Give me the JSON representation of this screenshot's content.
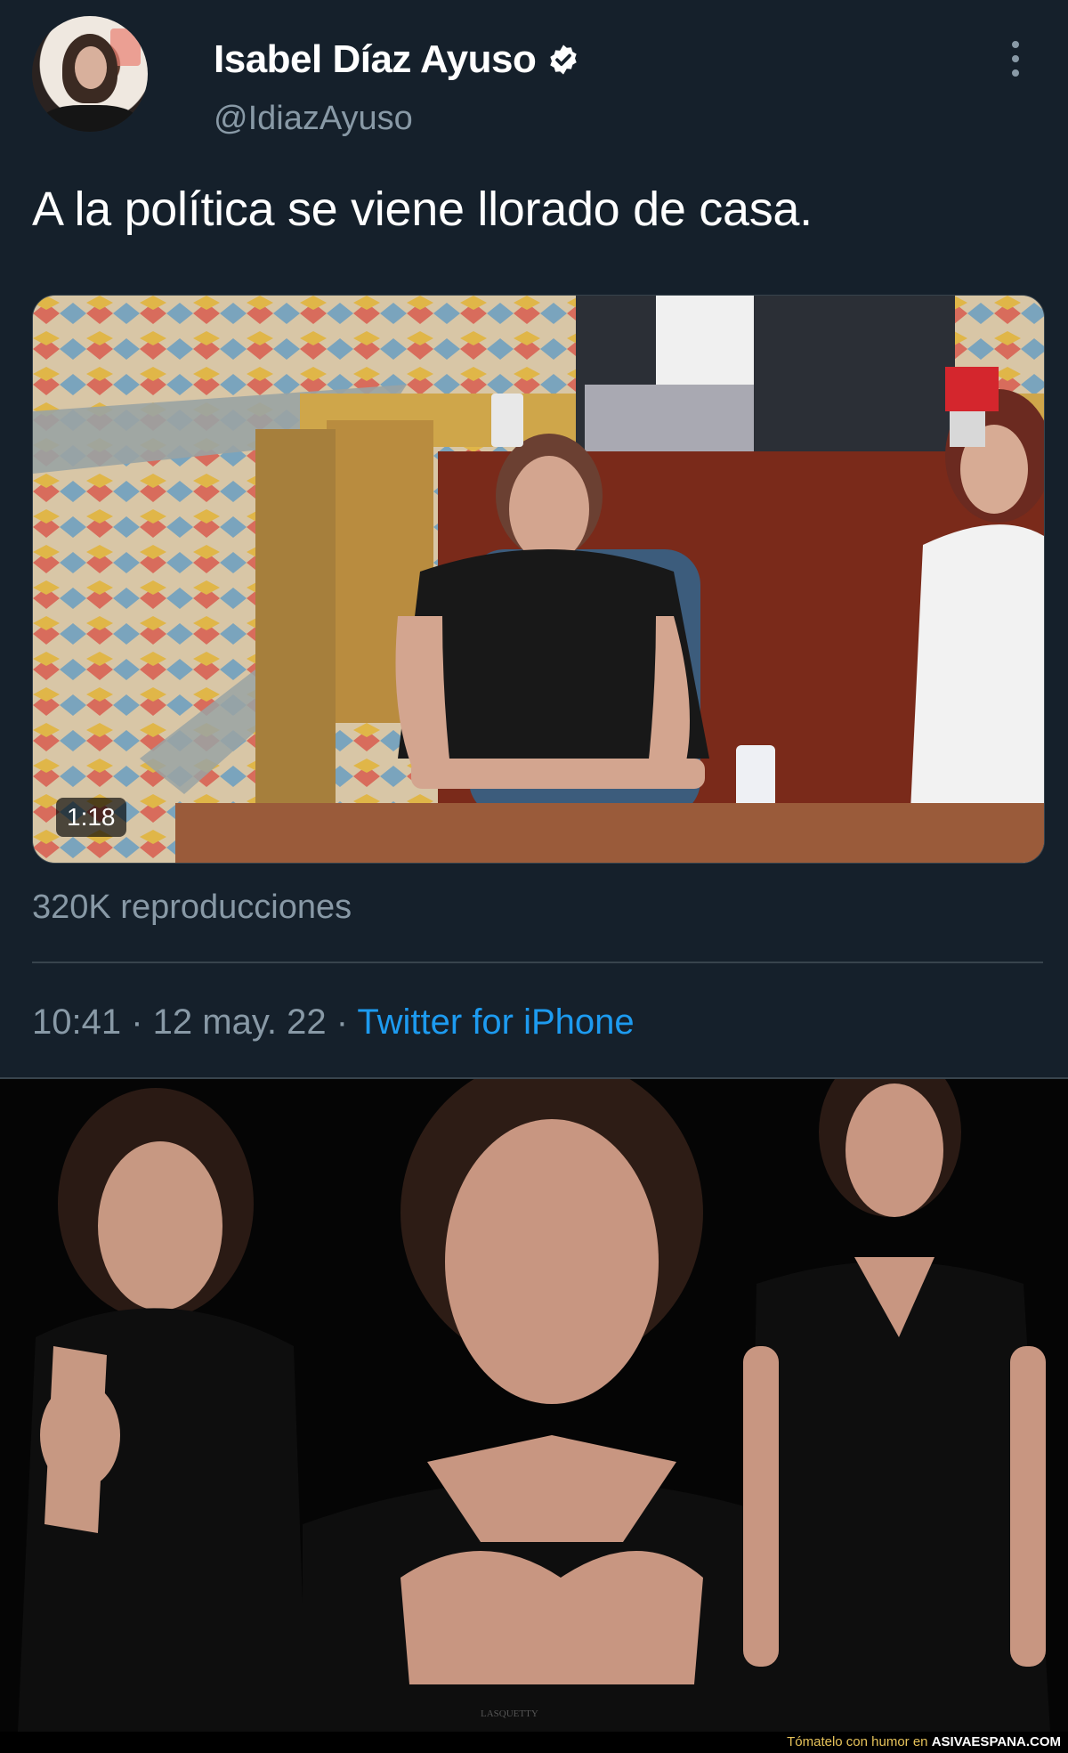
{
  "tweet": {
    "author_name": "Isabel Díaz Ayuso",
    "author_handle": "@IdiazAyuso",
    "text": "A la política se viene llorado de casa.",
    "video_duration": "1:18",
    "views": "320K reproducciones",
    "time": "10:41",
    "separator": " · ",
    "date": "12 may. 22",
    "source": "Twitter for iPhone"
  },
  "photos": {
    "credit": "LASQUETTY"
  },
  "footer": {
    "prefix": "Tómatelo con humor en ",
    "brand": "ASIVAESPANA.COM"
  },
  "colors": {
    "background": "#15202b",
    "secondary_text": "#8899a6",
    "link": "#1d9bf0",
    "verified": "#ffffff"
  },
  "icons": [
    "verified-badge-icon",
    "more-options-icon"
  ]
}
